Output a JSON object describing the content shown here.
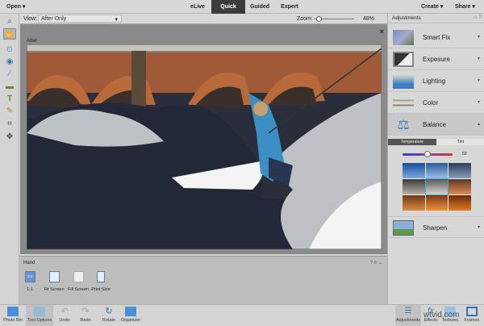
{
  "topbar": {
    "open": "Open",
    "tabs": [
      "eLive",
      "Quick",
      "Guided",
      "Expert"
    ],
    "active_tab": "Quick",
    "create": "Create",
    "share": "Share"
  },
  "viewbar": {
    "view_label": "View:",
    "view_value": "After Only",
    "zoom_label": "Zoom:",
    "zoom_value": "48%",
    "zoom_fraction": 0.12
  },
  "canvas": {
    "label": "After",
    "close": "×"
  },
  "tools": [
    "zoom",
    "hand",
    "quick-selection",
    "red-eye",
    "whiten-teeth",
    "straighten",
    "type",
    "spot-healing",
    "crop",
    "move"
  ],
  "hand_panel": {
    "title": "Hand",
    "options": [
      "1:1",
      "Fit Screen",
      "Fill Screen",
      "Print Size"
    ],
    "one_to_one_icon": "1:1"
  },
  "adjustments": {
    "title": "Adjustments",
    "items": [
      "Smart Fix",
      "Exposure",
      "Lighting",
      "Color",
      "Balance",
      "Sharpen"
    ],
    "expanded": "Balance",
    "balance": {
      "tabs": [
        "Temperature",
        "Tint"
      ],
      "active_tab": "Temperature",
      "slider_value": "50"
    }
  },
  "bottombar": {
    "left": [
      "Photo Bin",
      "Tool Options",
      "Undo",
      "Redo",
      "Rotate",
      "Organizer"
    ],
    "right": [
      "Adjustments",
      "Effects",
      "Textures",
      "Frames"
    ]
  },
  "watermark": "wtvid.com",
  "colors": {
    "accent": "#3c3c3c",
    "selection": "#4a8fd6"
  }
}
